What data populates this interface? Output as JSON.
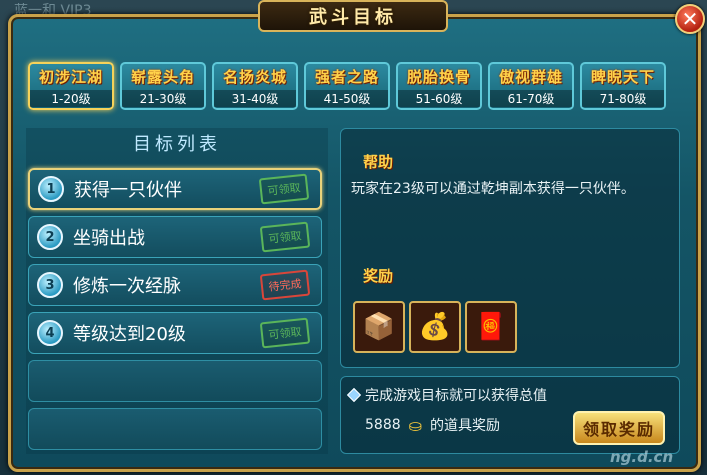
{
  "background": {
    "ghost_text": "蓝一和 VIP3"
  },
  "window": {
    "title": "武斗目标",
    "close_label": "✕"
  },
  "tabs": [
    {
      "name": "初涉江湖",
      "range": "1-20级",
      "active": true
    },
    {
      "name": "崭露头角",
      "range": "21-30级",
      "active": false
    },
    {
      "name": "名扬炎城",
      "range": "31-40级",
      "active": false
    },
    {
      "name": "强者之路",
      "range": "41-50级",
      "active": false
    },
    {
      "name": "脱胎换骨",
      "range": "51-60级",
      "active": false
    },
    {
      "name": "傲视群雄",
      "range": "61-70级",
      "active": false
    },
    {
      "name": "睥睨天下",
      "range": "71-80级",
      "active": false
    }
  ],
  "goal_list": {
    "header": "目标列表",
    "items": [
      {
        "num": "1",
        "text": "获得一只伙伴",
        "status": "可领取",
        "status_type": "claimable",
        "active": true
      },
      {
        "num": "2",
        "text": "坐骑出战",
        "status": "可领取",
        "status_type": "claimable",
        "active": false
      },
      {
        "num": "3",
        "text": "修炼一次经脉",
        "status": "待完成",
        "status_type": "pending",
        "active": false
      },
      {
        "num": "4",
        "text": "等级达到20级",
        "status": "可领取",
        "status_type": "claimable",
        "active": false
      }
    ]
  },
  "help": {
    "label": "帮助",
    "text": "玩家在23级可以通过乾坤副本获得一只伙伴。"
  },
  "reward": {
    "label": "奖励",
    "icons": [
      "package-icon",
      "gold-ingot-icon",
      "red-envelope-icon"
    ]
  },
  "total": {
    "line1": "完成游戏目标就可以获得总值",
    "amount": "5888",
    "line2_suffix": "的道具奖励",
    "claim_label": "领取奖励"
  },
  "watermark": "ng.d.cn",
  "colors": {
    "accent_gold": "#ffd24a",
    "frame": "#c9a24a",
    "panel": "#145566"
  }
}
